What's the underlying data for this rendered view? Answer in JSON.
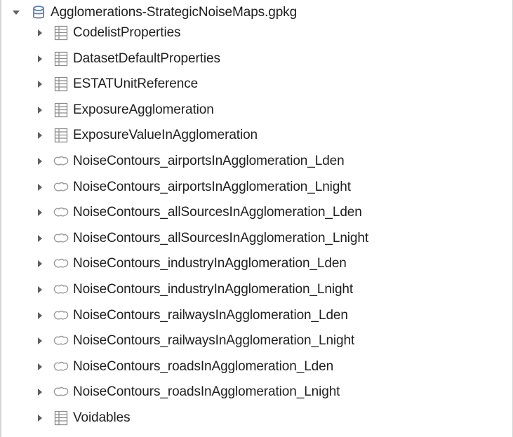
{
  "tree": {
    "root": {
      "label": "Agglomerations-StrategicNoiseMaps.gpkg",
      "icon": "database-icon",
      "expanded": true
    },
    "children": [
      {
        "label": "CodelistProperties",
        "icon": "table-icon"
      },
      {
        "label": "DatasetDefaultProperties",
        "icon": "table-icon"
      },
      {
        "label": "ESTATUnitReference",
        "icon": "table-icon"
      },
      {
        "label": "ExposureAgglomeration",
        "icon": "table-icon"
      },
      {
        "label": "ExposureValueInAgglomeration",
        "icon": "table-icon"
      },
      {
        "label": "NoiseContours_airportsInAgglomeration_Lden",
        "icon": "polygon-layer-icon"
      },
      {
        "label": "NoiseContours_airportsInAgglomeration_Lnight",
        "icon": "polygon-layer-icon"
      },
      {
        "label": "NoiseContours_allSourcesInAgglomeration_Lden",
        "icon": "polygon-layer-icon"
      },
      {
        "label": "NoiseContours_allSourcesInAgglomeration_Lnight",
        "icon": "polygon-layer-icon"
      },
      {
        "label": "NoiseContours_industryInAgglomeration_Lden",
        "icon": "polygon-layer-icon"
      },
      {
        "label": "NoiseContours_industryInAgglomeration_Lnight",
        "icon": "polygon-layer-icon"
      },
      {
        "label": "NoiseContours_railwaysInAgglomeration_Lden",
        "icon": "polygon-layer-icon"
      },
      {
        "label": "NoiseContours_railwaysInAgglomeration_Lnight",
        "icon": "polygon-layer-icon"
      },
      {
        "label": "NoiseContours_roadsInAgglomeration_Lden",
        "icon": "polygon-layer-icon"
      },
      {
        "label": "NoiseContours_roadsInAgglomeration_Lnight",
        "icon": "polygon-layer-icon"
      },
      {
        "label": "Voidables",
        "icon": "table-icon"
      }
    ]
  },
  "colors": {
    "text": "#1f1f1f",
    "arrow": "#5f5f5f",
    "database_icon": "#5f7fb8",
    "table_icon": "#8c8c8c",
    "polygon_icon": "#9a9a9a",
    "frame": "#d6d6d6"
  }
}
